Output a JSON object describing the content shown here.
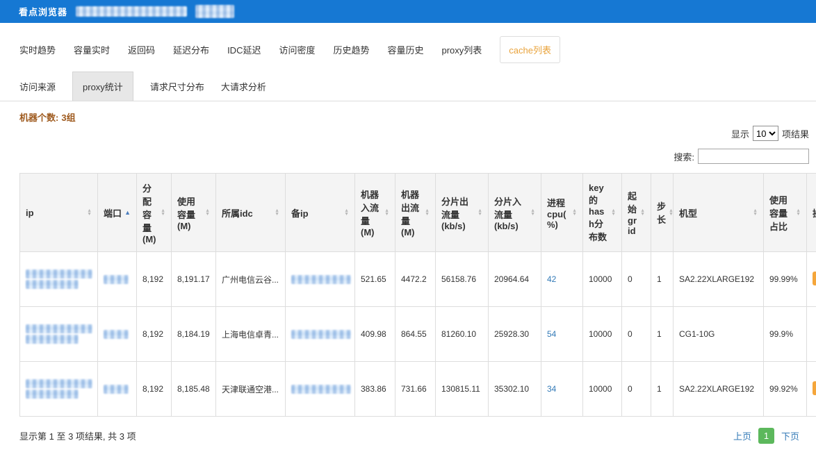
{
  "colors": {
    "header_blue": "#1678d3",
    "accent_orange": "#e9a33b",
    "link_blue": "#337ab7",
    "page_green": "#5cb85c",
    "summary_brown": "#9e5a1e",
    "action_orange": "#f5a63b"
  },
  "header": {
    "title": "看点浏览器"
  },
  "tabs_primary": [
    {
      "label": "实时趋势",
      "active": false
    },
    {
      "label": "容量实时",
      "active": false
    },
    {
      "label": "返回码",
      "active": false
    },
    {
      "label": "延迟分布",
      "active": false
    },
    {
      "label": "IDC延迟",
      "active": false
    },
    {
      "label": "访问密度",
      "active": false
    },
    {
      "label": "历史趋势",
      "active": false
    },
    {
      "label": "容量历史",
      "active": false
    },
    {
      "label": "proxy列表",
      "active": false
    },
    {
      "label": "cache列表",
      "active": true
    }
  ],
  "tabs_secondary": [
    {
      "label": "访问来源",
      "active": false
    },
    {
      "label": "proxy统计",
      "active": true
    },
    {
      "label": "请求尺寸分布",
      "active": false
    },
    {
      "label": "大请求分析",
      "active": false
    }
  ],
  "summary": {
    "label": "机器个数:",
    "value": "3组"
  },
  "controls": {
    "show_prefix": "显示",
    "show_value": "10",
    "show_options": [
      "10"
    ],
    "show_suffix": "项结果",
    "search_label": "搜索:"
  },
  "table": {
    "redacted_columns": [
      "ip",
      "端口",
      "备ip"
    ],
    "columns": [
      {
        "label": "ip",
        "sort": "both"
      },
      {
        "label": "端口",
        "sort": "asc"
      },
      {
        "label": "分配容量(M)",
        "sort": "both"
      },
      {
        "label": "使用容量(M)",
        "sort": "both"
      },
      {
        "label": "所属idc",
        "sort": "both"
      },
      {
        "label": "备ip",
        "sort": "both"
      },
      {
        "label": "机器入流量(M)",
        "sort": "both"
      },
      {
        "label": "机器出流量(M)",
        "sort": "both"
      },
      {
        "label": "分片出流量(kb/s)",
        "sort": "both"
      },
      {
        "label": "分片入流量(kb/s)",
        "sort": "both"
      },
      {
        "label": "进程cpu(%)",
        "sort": "both"
      },
      {
        "label": "key的hash分布数",
        "sort": "both"
      },
      {
        "label": "起始grid",
        "sort": "both"
      },
      {
        "label": "步长",
        "sort": "both"
      },
      {
        "label": "机型",
        "sort": "both"
      },
      {
        "label": "使用容量占比",
        "sort": "both"
      },
      {
        "label": "操作",
        "sort": "none"
      }
    ],
    "rows": [
      {
        "alloc": "8,192",
        "used": "8,191.17",
        "idc": "广州电信云谷...",
        "in_flow": "521.65",
        "out_flow": "4472.2",
        "shard_out": "56158.76",
        "shard_in": "20964.64",
        "cpu": "42",
        "hash": "10000",
        "grid": "0",
        "step": "1",
        "model": "SA2.22XLARGE192",
        "ratio": "99.99%",
        "action": true
      },
      {
        "alloc": "8,192",
        "used": "8,184.19",
        "idc": "上海电信卓青...",
        "in_flow": "409.98",
        "out_flow": "864.55",
        "shard_out": "81260.10",
        "shard_in": "25928.30",
        "cpu": "54",
        "hash": "10000",
        "grid": "0",
        "step": "1",
        "model": "CG1-10G",
        "ratio": "99.9%",
        "action": false
      },
      {
        "alloc": "8,192",
        "used": "8,185.48",
        "idc": "天津联通空港...",
        "in_flow": "383.86",
        "out_flow": "731.66",
        "shard_out": "130815.11",
        "shard_in": "35302.10",
        "cpu": "34",
        "hash": "10000",
        "grid": "0",
        "step": "1",
        "model": "SA2.22XLARGE192",
        "ratio": "99.92%",
        "action": true
      }
    ]
  },
  "footer": {
    "info": "显示第 1 至 3 项结果, 共 3 项",
    "prev": "上页",
    "page": "1",
    "next": "下页"
  }
}
